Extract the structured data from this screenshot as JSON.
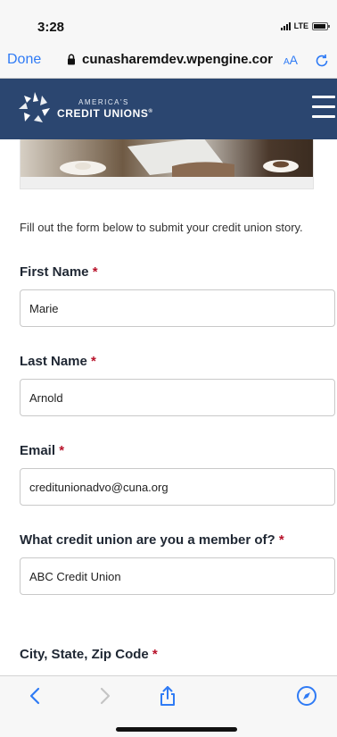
{
  "status": {
    "time": "3:28",
    "network": "LTE"
  },
  "browser": {
    "done_label": "Done",
    "url": "cunasharemdev.wpengine.cor",
    "text_size_label_small": "A",
    "text_size_label_large": "A",
    "accent_color": "#2f7bf5"
  },
  "site": {
    "logo_line1": "AMERICA'S",
    "logo_line2": "CREDIT UNIONS",
    "logo_mark": "®",
    "header_color": "#2b4670"
  },
  "form": {
    "intro": "Fill out the form below to submit your credit union story.",
    "required_marker": "*",
    "fields": [
      {
        "label": "First Name",
        "value": "Marie"
      },
      {
        "label": "Last Name",
        "value": "Arnold"
      },
      {
        "label": "Email",
        "value": "creditunionadvo@cuna.org"
      },
      {
        "label": "What credit union are you a member of?",
        "value": "ABC Credit Union"
      },
      {
        "label": "City, State, Zip Code",
        "value": ""
      }
    ]
  },
  "toolbar": {
    "icons": [
      "back-icon",
      "forward-icon",
      "share-icon",
      "compass-icon"
    ]
  }
}
